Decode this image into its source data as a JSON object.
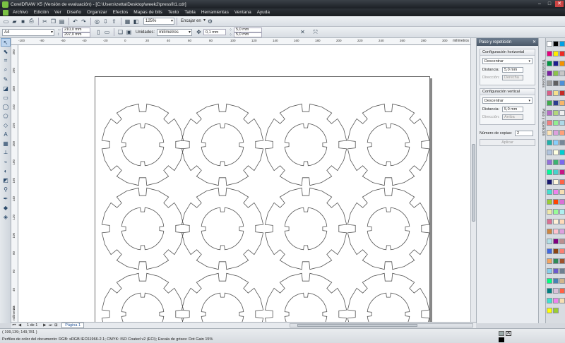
{
  "window": {
    "title": "CorelDRAW X5 (Versión de evaluación) - [C:\\Users\\zetta\\Desktop\\week2\\pressfit1.cdr]"
  },
  "menu": [
    "Archivo",
    "Edición",
    "Ver",
    "Diseño",
    "Organizar",
    "Efectos",
    "Mapas de bits",
    "Texto",
    "Tabla",
    "Herramientas",
    "Ventana",
    "Ayuda"
  ],
  "toolbar": {
    "zoom": "125%",
    "snap": "Encajar en"
  },
  "propbar": {
    "paper": "A4",
    "width": "210,0 mm",
    "height": "297,0 mm",
    "units_label": "Unidades:",
    "units": "milímetros",
    "nudge": "0,1 mm",
    "dup_x": "5,0 mm",
    "dup_y": "5,0 mm"
  },
  "ruler": {
    "unit": "milímetros",
    "top_ticks": [
      "-100",
      "-80",
      "-60",
      "-40",
      "-20",
      "0",
      "20",
      "40",
      "60",
      "80",
      "100",
      "120",
      "140",
      "160",
      "180",
      "200",
      "220",
      "240",
      "260",
      "280",
      "300"
    ],
    "left_ticks": [
      "300",
      "280",
      "260",
      "240",
      "220",
      "200",
      "180",
      "160",
      "140",
      "120",
      "100",
      "80",
      "60",
      "40",
      "20"
    ],
    "left_unit": "milímetros"
  },
  "docker": {
    "title": "Paso y repetición",
    "horizontal": {
      "title": "Configuración horizontal",
      "mode": "Descentrar",
      "distance_label": "Distancia:",
      "distance": "5,0 mm",
      "direction_label": "Dirección:",
      "direction": "Derecha"
    },
    "vertical": {
      "title": "Configuración vertical",
      "mode": "Descentrar",
      "distance_label": "Distancia:",
      "distance": "5,0 mm",
      "direction_label": "Dirección:",
      "direction": "Arriba"
    },
    "copies_label": "Número de copias:",
    "copies": "2",
    "apply": "Aplicar",
    "tabs": [
      "Transformaciones",
      "Paso y repetición"
    ]
  },
  "pagenav": {
    "pages": "1 de 1",
    "tab": "Página 1"
  },
  "status": {
    "coords": "( 199,139; 149,781 )",
    "profile": "Perfiles de color del documento: RGB: sRGB IEC61966-2.1; CMYK: ISO Coated v2 (ECI); Escala de grises: Dot Gain 15%"
  },
  "colors": {
    "accent": "#7ac143",
    "palette": [
      "#ffffff",
      "#000000",
      "#00a0e3",
      "#e6007e",
      "#ffed00",
      "#ee2a24",
      "#009640",
      "#1d1d8f",
      "#f39200",
      "#7b1fa2",
      "#8bc34a",
      "#c6c6c6",
      "#a0a0a0",
      "#606060",
      "#4e8fd6",
      "#d95f87",
      "#f6e08a",
      "#c52b27",
      "#3eab4a",
      "#2a3d8f",
      "#f7b56a",
      "#b76ac6",
      "#b3d67a",
      "#eeeeee",
      "#f08080",
      "#90ee90",
      "#add8e6",
      "#ffe4b5",
      "#dda0dd",
      "#ffa07a",
      "#20b2aa",
      "#87cefa",
      "#778899",
      "#b0c4de",
      "#ffffe0",
      "#00ced1",
      "#9370db",
      "#3cb371",
      "#7b68ee",
      "#00fa9a",
      "#48d1cc",
      "#c71585",
      "#191970",
      "#fff8dc",
      "#ff6347",
      "#40e0d0",
      "#ee82ee",
      "#f5deb3",
      "#9acd32",
      "#ff4500",
      "#da70d6",
      "#eee8aa",
      "#98fb98",
      "#afeeee",
      "#db7093",
      "#ffefd5",
      "#ffdab9",
      "#cd853f",
      "#ffc0cb",
      "#dda0dd",
      "#b0e0e6",
      "#800080",
      "#bc8f8f",
      "#4169e1",
      "#8b4513",
      "#fa8072",
      "#f4a460",
      "#2e8b57",
      "#a0522d",
      "#87ceeb",
      "#6a5acd",
      "#708090",
      "#00ff7f",
      "#4682b4",
      "#d2b48c",
      "#008080",
      "#d8bfd8",
      "#ff6347",
      "#40e0d0",
      "#ee82ee",
      "#f5deb3",
      "#ffff00",
      "#9acd32"
    ]
  }
}
